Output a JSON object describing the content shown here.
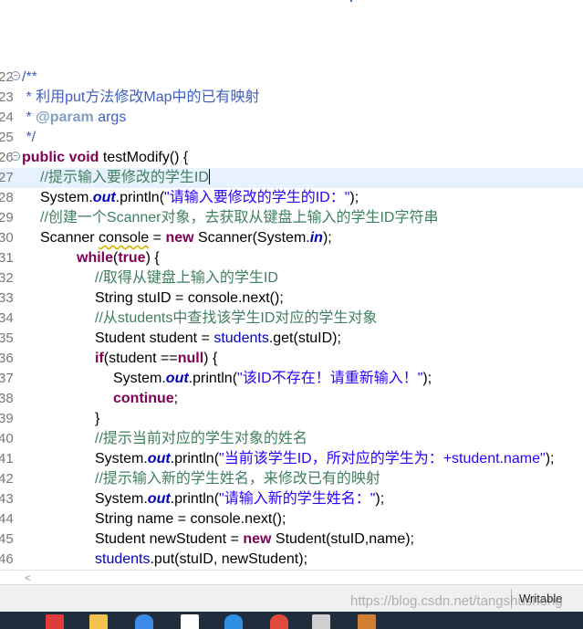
{
  "editor": {
    "lines": [
      {
        "num": "22",
        "fold": true,
        "indent": 24,
        "segs": [
          {
            "t": "/**",
            "c": "jd"
          }
        ]
      },
      {
        "num": "23",
        "indent": 24,
        "segs": [
          {
            "t": " * 利用put方法修改Map中的已有映射",
            "c": "jd"
          }
        ]
      },
      {
        "num": "24",
        "indent": 24,
        "segs": [
          {
            "t": " * ",
            "c": "jd"
          },
          {
            "t": "@param",
            "c": "jdtag"
          },
          {
            "t": " args",
            "c": "jd"
          }
        ]
      },
      {
        "num": "25",
        "indent": 24,
        "segs": [
          {
            "t": " */",
            "c": "jd"
          }
        ]
      },
      {
        "num": "26",
        "fold": true,
        "indent": 24,
        "segs": [
          {
            "t": "public",
            "c": "kw"
          },
          {
            "t": " "
          },
          {
            "t": "void",
            "c": "kw"
          },
          {
            "t": " testModify() {"
          }
        ]
      },
      {
        "num": "27",
        "indent": 44,
        "current": true,
        "caret": true,
        "segs": [
          {
            "t": "//提示输入要修改的学生ID",
            "c": "cm"
          }
        ]
      },
      {
        "num": "28",
        "indent": 44,
        "segs": [
          {
            "t": "System."
          },
          {
            "t": "out",
            "c": "sfld"
          },
          {
            "t": ".println("
          },
          {
            "t": "\"请输入要修改的学生的ID：\"",
            "c": "str"
          },
          {
            "t": ");"
          }
        ]
      },
      {
        "num": "29",
        "indent": 44,
        "segs": [
          {
            "t": "//创建一个Scanner对象，去获取从键盘上输入的学生ID字符串",
            "c": "cm"
          }
        ]
      },
      {
        "num": "30",
        "indent": 44,
        "segs": [
          {
            "t": "Scanner "
          },
          {
            "t": "console",
            "c": "warn"
          },
          {
            "t": " = "
          },
          {
            "t": "new",
            "c": "kw"
          },
          {
            "t": " Scanner(System."
          },
          {
            "t": "in",
            "c": "sfld"
          },
          {
            "t": ");"
          }
        ]
      },
      {
        "num": "31",
        "indent": 84,
        "segs": [
          {
            "t": "while",
            "c": "kw"
          },
          {
            "t": "("
          },
          {
            "t": "true",
            "c": "kw"
          },
          {
            "t": ") {"
          }
        ]
      },
      {
        "num": "32",
        "indent": 104,
        "segs": [
          {
            "t": "//取得从键盘上输入的学生ID",
            "c": "cm"
          }
        ]
      },
      {
        "num": "33",
        "indent": 104,
        "segs": [
          {
            "t": "String stuID = console.next();"
          }
        ]
      },
      {
        "num": "34",
        "indent": 104,
        "segs": [
          {
            "t": "//从students中查找该学生ID对应的学生对象",
            "c": "cm"
          }
        ]
      },
      {
        "num": "35",
        "indent": 104,
        "segs": [
          {
            "t": "Student student = "
          },
          {
            "t": "students",
            "c": "fld"
          },
          {
            "t": ".get(stuID);"
          }
        ]
      },
      {
        "num": "36",
        "indent": 104,
        "segs": [
          {
            "t": "if",
            "c": "kw"
          },
          {
            "t": "(student =="
          },
          {
            "t": "null",
            "c": "kw"
          },
          {
            "t": ") {"
          }
        ]
      },
      {
        "num": "37",
        "indent": 124,
        "segs": [
          {
            "t": "System."
          },
          {
            "t": "out",
            "c": "sfld"
          },
          {
            "t": ".println("
          },
          {
            "t": "\"该ID不存在！请重新输入！\"",
            "c": "str"
          },
          {
            "t": ");"
          }
        ]
      },
      {
        "num": "38",
        "indent": 124,
        "segs": [
          {
            "t": "continue",
            "c": "kw"
          },
          {
            "t": ";"
          }
        ]
      },
      {
        "num": "39",
        "indent": 104,
        "segs": [
          {
            "t": "}"
          }
        ]
      },
      {
        "num": "40",
        "indent": 104,
        "segs": [
          {
            "t": "//提示当前对应的学生对象的姓名",
            "c": "cm"
          }
        ]
      },
      {
        "num": "41",
        "indent": 104,
        "segs": [
          {
            "t": "System."
          },
          {
            "t": "out",
            "c": "sfld"
          },
          {
            "t": ".println("
          },
          {
            "t": "\"当前该学生ID，所对应的学生为：+student.name\"",
            "c": "str"
          },
          {
            "t": ");"
          }
        ]
      },
      {
        "num": "42",
        "indent": 104,
        "segs": [
          {
            "t": "//提示输入新的学生姓名，来修改已有的映射",
            "c": "cm"
          }
        ]
      },
      {
        "num": "43",
        "indent": 104,
        "segs": [
          {
            "t": "System."
          },
          {
            "t": "out",
            "c": "sfld"
          },
          {
            "t": ".println("
          },
          {
            "t": "\"请输入新的学生姓名：\"",
            "c": "str"
          },
          {
            "t": ");"
          }
        ]
      },
      {
        "num": "44",
        "indent": 104,
        "segs": [
          {
            "t": "String name = console.next();"
          }
        ]
      },
      {
        "num": "45",
        "indent": 104,
        "segs": [
          {
            "t": "Student newStudent = "
          },
          {
            "t": "new",
            "c": "kw"
          },
          {
            "t": " Student(stuID,name);"
          }
        ]
      },
      {
        "num": "46",
        "indent": 104,
        "segs": [
          {
            "t": "students",
            "c": "fld"
          },
          {
            "t": ".put(stuID, newStudent);"
          }
        ]
      }
    ]
  },
  "hscroll": {
    "left_arrow": "<"
  },
  "status": {
    "writable": "Writable"
  },
  "watermark": "https://blog.csdn.net/tangshusheng",
  "colors": {
    "keyword": "#7f0055",
    "comment": "#3f7f5f",
    "javadoc": "#3f5fbf",
    "string": "#2a00ff",
    "field": "#0000c0",
    "current_line": "#e8f2fe"
  },
  "taskbar": {
    "icons": [
      {
        "name": "store-icon",
        "color": "#e23b3b"
      },
      {
        "name": "file-explorer-icon",
        "color": "#f2c14e"
      },
      {
        "name": "browser-icon",
        "color": "#3d8be8"
      },
      {
        "name": "app-icon",
        "color": "#ffffff"
      },
      {
        "name": "edge-icon",
        "color": "#2f8fe0"
      },
      {
        "name": "chrome-icon",
        "color": "#e04a3a"
      },
      {
        "name": "terminal-icon",
        "color": "#cfcfcf"
      },
      {
        "name": "eclipse-icon",
        "color": "#d08030"
      }
    ]
  }
}
